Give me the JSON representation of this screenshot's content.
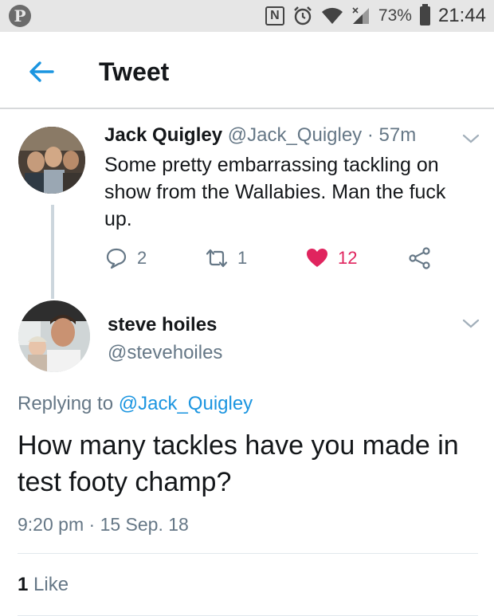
{
  "status_bar": {
    "app_icon": "pinterest-icon",
    "nfc_label": "N",
    "battery_percent": "73%",
    "time": "21:44"
  },
  "app_bar": {
    "title": "Tweet"
  },
  "parent_tweet": {
    "name": "Jack Quigley",
    "handle": "@Jack_Quigley",
    "separator": "·",
    "time_ago": "57m",
    "text": "Some pretty embarrassing tackling on show from the Wallabies. Man the fuck up.",
    "reply_count": "2",
    "retweet_count": "1",
    "like_count": "12",
    "like_color": "#e0245e"
  },
  "reply_tweet": {
    "name": "steve hoiles",
    "handle": "@stevehoiles",
    "replying_prefix": "Replying to ",
    "replying_to": "@Jack_Quigley",
    "text": "How many tackles have you made in test footy champ?",
    "time": "9:20 pm",
    "separator": "·",
    "date": "15 Sep. 18",
    "likes_count": "1",
    "likes_label": "Like"
  },
  "colors": {
    "accent": "#1b95e0",
    "secondary_text": "#657786",
    "like": "#e0245e"
  }
}
